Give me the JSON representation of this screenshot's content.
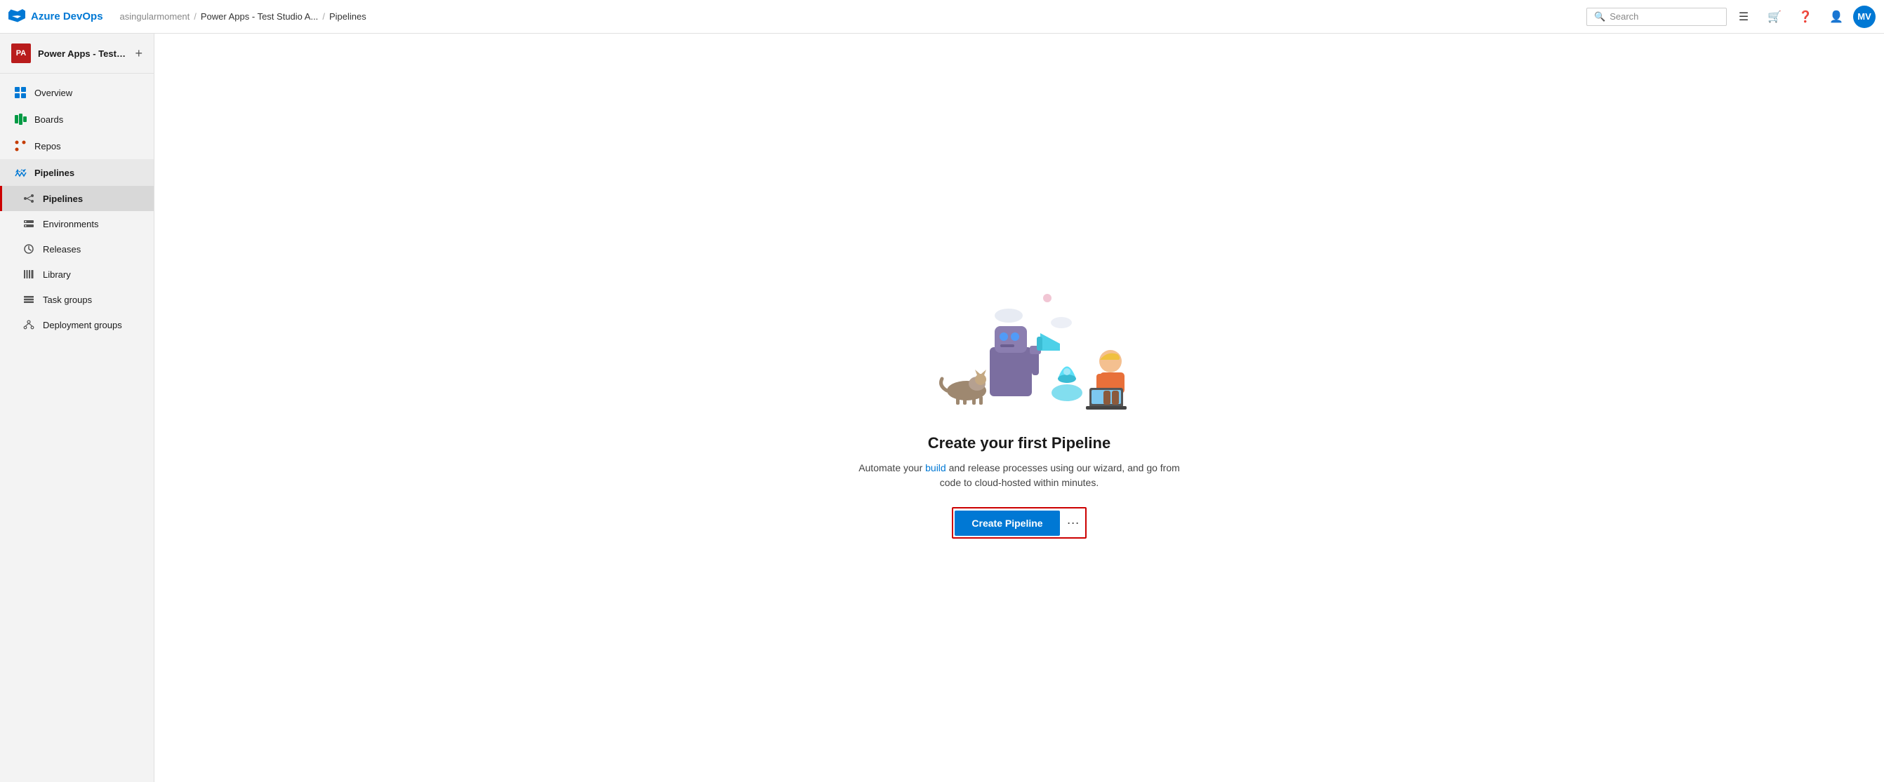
{
  "topNav": {
    "logo": "Azure DevOps",
    "breadcrumb": {
      "org": "asingularmoment",
      "sep1": "/",
      "project": "Power Apps - Test Studio A...",
      "sep2": "/",
      "current": "Pipelines"
    },
    "search": {
      "placeholder": "Search"
    },
    "userInitials": "MV"
  },
  "sidebar": {
    "project": {
      "initials": "PA",
      "name": "Power Apps - Test Stud...",
      "addTitle": "+"
    },
    "items": [
      {
        "id": "overview",
        "label": "Overview",
        "icon": "overview"
      },
      {
        "id": "boards",
        "label": "Boards",
        "icon": "boards"
      },
      {
        "id": "repos",
        "label": "Repos",
        "icon": "repos"
      },
      {
        "id": "pipelines-section",
        "label": "Pipelines",
        "icon": "pipelines"
      },
      {
        "id": "pipelines",
        "label": "Pipelines",
        "icon": "pipelines-sub",
        "sub": true,
        "active": true
      },
      {
        "id": "environments",
        "label": "Environments",
        "icon": "environments",
        "sub": true
      },
      {
        "id": "releases",
        "label": "Releases",
        "icon": "releases",
        "sub": true
      },
      {
        "id": "library",
        "label": "Library",
        "icon": "library",
        "sub": true
      },
      {
        "id": "taskgroups",
        "label": "Task groups",
        "icon": "taskgroups",
        "sub": true
      },
      {
        "id": "deploygroups",
        "label": "Deployment groups",
        "icon": "deploygroups",
        "sub": true
      }
    ]
  },
  "emptyState": {
    "title": "Create your first Pipeline",
    "description": "Automate your build and release processes using our wizard, and go from code to cloud-hosted within minutes.",
    "createButtonLabel": "Create Pipeline",
    "moreLabel": "⋯"
  }
}
